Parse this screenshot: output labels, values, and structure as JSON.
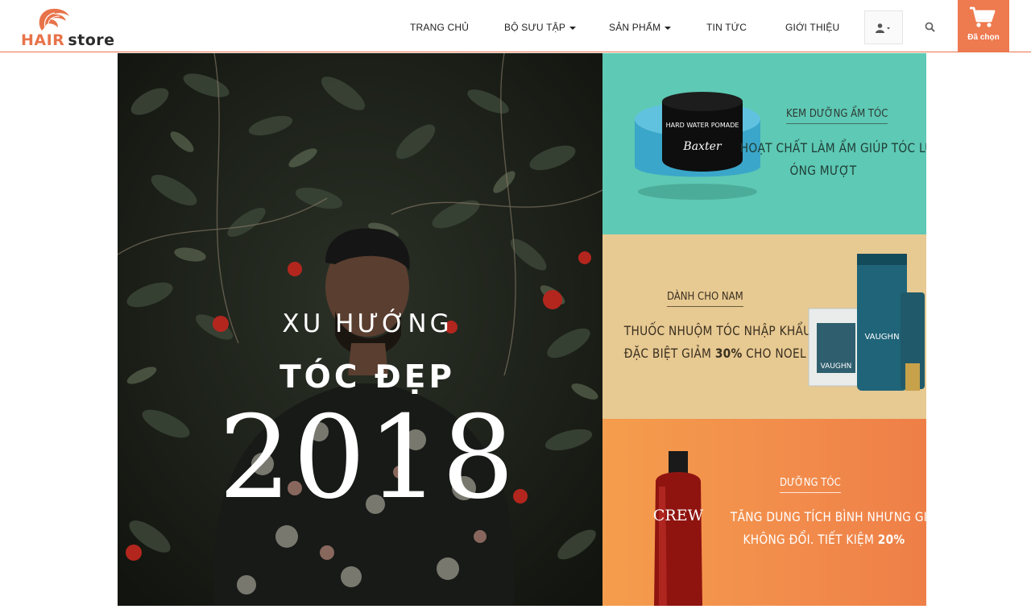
{
  "brand": {
    "name_part1": "HAIR",
    "name_part2": "store",
    "accent_color": "#ee7a4f"
  },
  "nav": {
    "items": [
      {
        "label": "TRANG CHỦ",
        "has_dropdown": false
      },
      {
        "label": "BỘ SƯU TẬP",
        "has_dropdown": true
      },
      {
        "label": "SẢN PHẨM",
        "has_dropdown": true
      },
      {
        "label": "TIN TỨC",
        "has_dropdown": false
      },
      {
        "label": "GIỚI THIỆU",
        "has_dropdown": false
      }
    ],
    "user_icon": "user-icon",
    "search_icon": "search-icon",
    "cart": {
      "icon": "cart-icon",
      "label": "Đã chọn"
    }
  },
  "hero": {
    "line1": "XU HƯỚNG",
    "line2": "TÓC ĐẸP",
    "year": "2018"
  },
  "promos": [
    {
      "tag": "KEM DƯỠNG ẨM TÓC",
      "headline_line1": "HOẠT CHẤT LÀM ẨM GIÚP TÓC LUÔN",
      "headline_line2": "ÓNG MƯỢT",
      "product_label_1": "HARD WATER POMADE",
      "product_label_2": "Baxter",
      "color": "#5ec9b4"
    },
    {
      "tag": "DÀNH CHO NAM",
      "headline_line1": "THUỐC NHUỘM TÓC NHẬP KHẨU",
      "headline_line2_pre": "ĐẶC BIỆT GIẢM ",
      "headline_line2_bold": "30%",
      "headline_line2_post": " CHO NOEL",
      "product_label": "VAUGHN",
      "color": "#e7c992"
    },
    {
      "tag": "DƯỠNG TÓC",
      "headline_line1": "TĂNG DUNG TÍCH BÌNH NHƯNG GIÁ",
      "headline_line2_pre": "KHÔNG ĐỔI. TIẾT KIỆM ",
      "headline_line2_bold": "20%",
      "product_label": "CREW",
      "color": "#f28d4c"
    }
  ]
}
